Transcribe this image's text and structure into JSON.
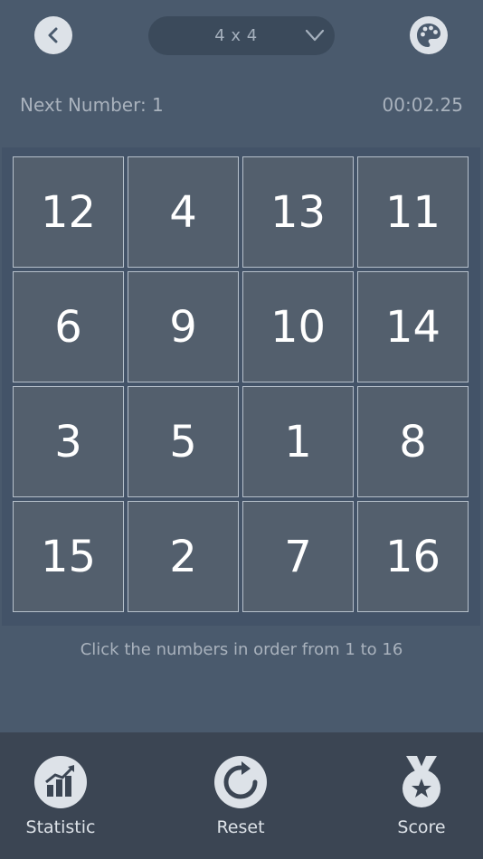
{
  "header": {
    "size_value": "4 x 4",
    "back_icon": "chevron-left-icon",
    "theme_icon": "palette-icon",
    "dropdown_icon": "chevron-down-icon"
  },
  "status": {
    "next_label": "Next Number: 1",
    "timer": "00:02.25"
  },
  "board": {
    "rows": 4,
    "cols": 4,
    "cells": [
      12,
      4,
      13,
      11,
      6,
      9,
      10,
      14,
      3,
      5,
      1,
      8,
      15,
      2,
      7,
      16
    ]
  },
  "hint": "Click the numbers in order from 1 to 16",
  "tabbar": {
    "items": [
      {
        "label": "Statistic",
        "icon": "statistic-chart-icon"
      },
      {
        "label": "Reset",
        "icon": "reset-icon"
      },
      {
        "label": "Score",
        "icon": "medal-star-icon"
      }
    ]
  },
  "colors": {
    "background": "#4a5a6d",
    "cell": "#535f6d",
    "cell_border": "#b6c0cb",
    "tabbar": "#3b4553",
    "icon_fill": "#dde2e8"
  }
}
